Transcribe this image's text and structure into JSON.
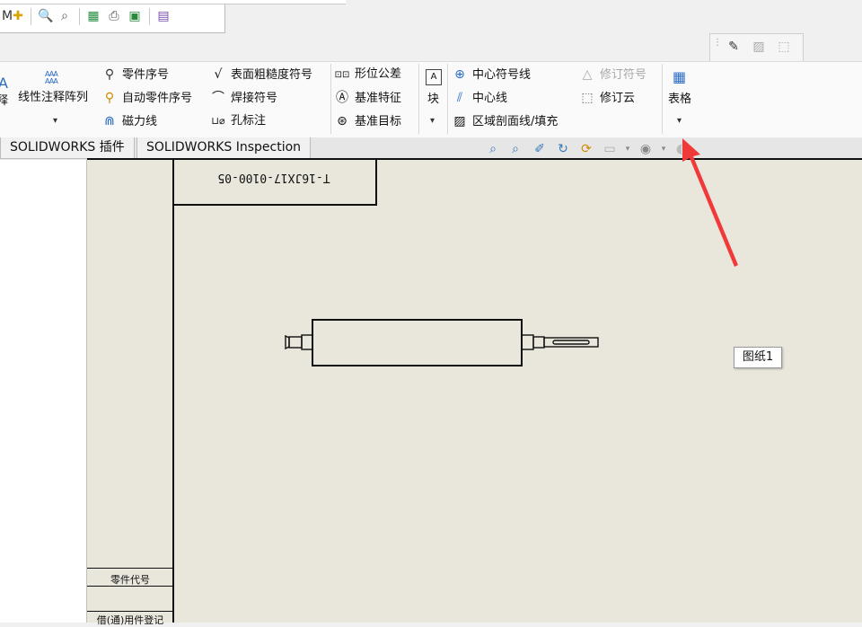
{
  "ribbon": {
    "annotation_label_partial": "释",
    "linear_note_pattern": "线性注释阵列",
    "balloon": "零件序号",
    "auto_balloon": "自动零件序号",
    "magnetic_line": "磁力线",
    "surface_finish": "表面粗糙度符号",
    "weld_symbol": "焊接符号",
    "hole_callout": "孔标注",
    "geometric_tolerance": "形位公差",
    "datum_feature": "基准特征",
    "datum_target": "基准目标",
    "block": "块",
    "center_mark": "中心符号线",
    "centerline": "中心线",
    "area_hatch": "区域剖面线/填充",
    "revision_symbol": "修订符号",
    "revision_cloud": "修订云",
    "table": "表格"
  },
  "tabs": [
    {
      "label": "SOLIDWORKS 插件"
    },
    {
      "label": "SOLIDWORKS Inspection"
    }
  ],
  "drawing": {
    "title_block_code": "T-16JX17-0100-05",
    "part_code_label": "零件代号",
    "bottom_cell_label": "借(通)用件登记",
    "sheet_name": "图纸1"
  },
  "colors": {
    "sheet_bg": "#e9e6dc",
    "arrow": "#f03a3a"
  }
}
